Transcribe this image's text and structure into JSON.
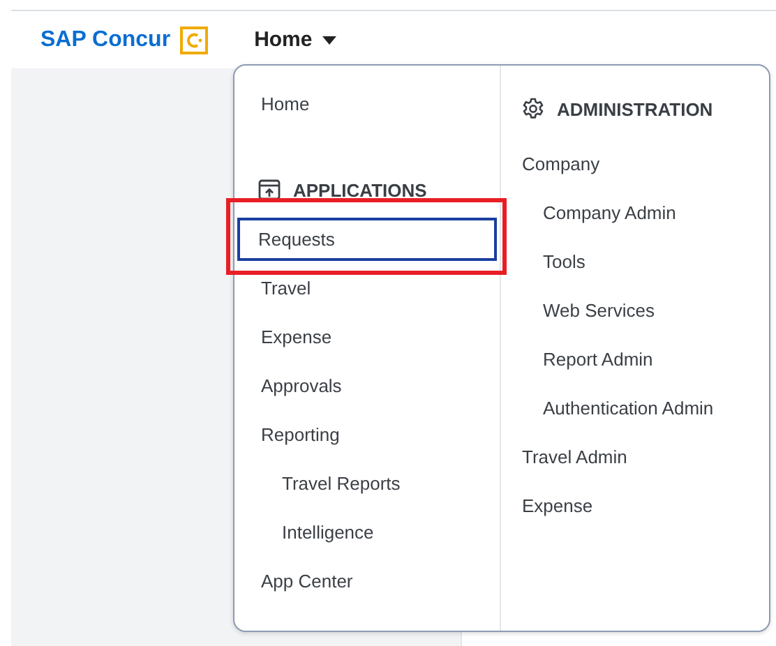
{
  "header": {
    "brand": "SAP Concur",
    "nav": {
      "label": "Home",
      "expanded": true
    }
  },
  "menu": {
    "columns": [
      {
        "items": [
          {
            "kind": "link",
            "label": "Home",
            "selected": false,
            "highlighted": false
          },
          {
            "kind": "heading",
            "label": "APPLICATIONS"
          },
          {
            "kind": "link",
            "label": "Requests",
            "selected": true,
            "highlighted": true
          },
          {
            "kind": "link",
            "label": "Travel",
            "selected": false,
            "highlighted": false
          },
          {
            "kind": "link",
            "label": "Expense",
            "selected": false,
            "highlighted": false
          },
          {
            "kind": "link",
            "label": "Approvals",
            "selected": false,
            "highlighted": false
          },
          {
            "kind": "link",
            "label": "Reporting",
            "selected": false,
            "highlighted": false,
            "children": [
              {
                "kind": "link",
                "label": "Travel Reports",
                "selected": false,
                "highlighted": false
              },
              {
                "kind": "link",
                "label": "Intelligence",
                "selected": false,
                "highlighted": false
              }
            ]
          },
          {
            "kind": "link",
            "label": "App Center",
            "selected": false,
            "highlighted": false
          }
        ]
      },
      {
        "items": [
          {
            "kind": "heading",
            "label": "ADMINISTRATION"
          },
          {
            "kind": "link",
            "label": "Company",
            "selected": false,
            "highlighted": false,
            "children": [
              {
                "kind": "link",
                "label": "Company Admin",
                "selected": false,
                "highlighted": false
              },
              {
                "kind": "link",
                "label": "Tools",
                "selected": false,
                "highlighted": false
              },
              {
                "kind": "link",
                "label": "Web Services",
                "selected": false,
                "highlighted": false
              },
              {
                "kind": "link",
                "label": "Report Admin",
                "selected": false,
                "highlighted": false
              },
              {
                "kind": "link",
                "label": "Authentication Admin",
                "selected": false,
                "highlighted": false
              }
            ]
          },
          {
            "kind": "link",
            "label": "Travel Admin",
            "selected": false,
            "highlighted": false
          },
          {
            "kind": "link",
            "label": "Expense",
            "selected": false,
            "highlighted": false
          }
        ]
      }
    ]
  }
}
